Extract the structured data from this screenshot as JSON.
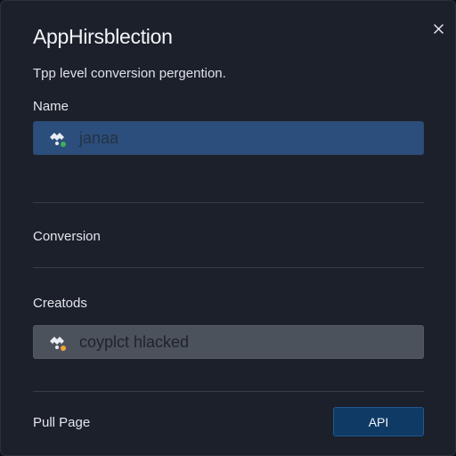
{
  "dialog": {
    "title": "AppHirsblection",
    "subtitle": "Tpp level conversion pergention.",
    "close_icon": "close-icon"
  },
  "name_field": {
    "label": "Name",
    "value": "janaa",
    "icon": "app-logo-icon",
    "icon_badge_color": "#3fae5a",
    "background_color": "#2c4e7d"
  },
  "conversion": {
    "label": "Conversion"
  },
  "credentials_field": {
    "label": "Creatods",
    "value": "coyplct hlacked",
    "icon": "app-logo-icon",
    "icon_badge_color": "#f2a23a",
    "background_color": "#4b525c"
  },
  "footer": {
    "pull_page_label": "Pull Page",
    "api_button_label": "API",
    "api_button_color": "#0f3a66"
  }
}
